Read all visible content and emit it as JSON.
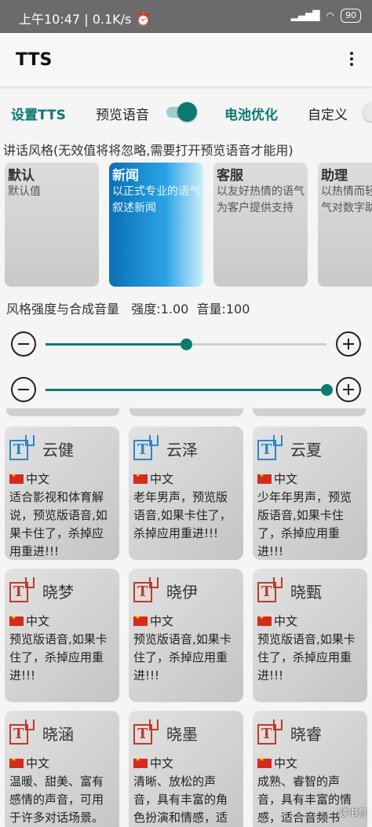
{
  "status": {
    "time": "上午10:47",
    "speed": "0.1K/s",
    "battery": "90"
  },
  "app": {
    "title": "TTS"
  },
  "tabs": [
    {
      "label": "设置TTS",
      "accent": true
    },
    {
      "label": "预览语音",
      "accent": false
    },
    {
      "label": "电池优化",
      "accent": true
    },
    {
      "label": "自定义",
      "accent": false
    }
  ],
  "preview_toggle": true,
  "custom_toggle": false,
  "hint": "讲话风格(无效值将将忽略,需要打开预览语音才能用)",
  "styles": [
    {
      "name": "默认",
      "desc": "默认值",
      "selected": false
    },
    {
      "name": "新闻",
      "desc": "以正式专业的语气叙述新闻",
      "selected": true
    },
    {
      "name": "客服",
      "desc": "以友好热情的语气为客户提供支持",
      "selected": false
    },
    {
      "name": "助理",
      "desc": "以热情而轻松的语气对数字助理讲话",
      "selected": false
    }
  ],
  "strength": {
    "label": "风格强度与合成音量",
    "intensity_label": "强度:1.00",
    "volume_label": "音量:100",
    "intensity": 0.5,
    "volume": 1.0
  },
  "voices": [
    {
      "name": "云健",
      "lang": "中文",
      "desc": "适合影视和体育解说，预览版语音,如果卡住了，杀掉应用重进!!!",
      "icon": "blue"
    },
    {
      "name": "云泽",
      "lang": "中文",
      "desc": "老年男声，预览版语音,如果卡住了，杀掉应用重进!!!",
      "icon": "blue"
    },
    {
      "name": "云夏",
      "lang": "中文",
      "desc": "少年年男声，预览版语音,如果卡住了，杀掉应用重进!!!",
      "icon": "blue"
    },
    {
      "name": "晓梦",
      "lang": "中文",
      "desc": "预览版语音,如果卡住了，杀掉应用重进!!!",
      "icon": "red"
    },
    {
      "name": "晓伊",
      "lang": "中文",
      "desc": "预览版语音,如果卡住了，杀掉应用重进!!!",
      "icon": "red"
    },
    {
      "name": "晓甄",
      "lang": "中文",
      "desc": "预览版语音,如果卡住了，杀掉应用重进!!!",
      "icon": "red"
    },
    {
      "name": "晓涵",
      "lang": "中文",
      "desc": "温暖、甜美、富有感情的声音，可用于许多对话场景。",
      "icon": "red"
    },
    {
      "name": "晓墨",
      "lang": "中文",
      "desc": "清晰、放松的声音，具有丰富的角色扮演和情感，适合音频书籍。",
      "icon": "red"
    },
    {
      "name": "晓睿",
      "lang": "中文",
      "desc": "成熟、睿智的声音，具有丰富的情感，适合音频书籍。",
      "icon": "red"
    }
  ],
  "watermark": "读书荒"
}
